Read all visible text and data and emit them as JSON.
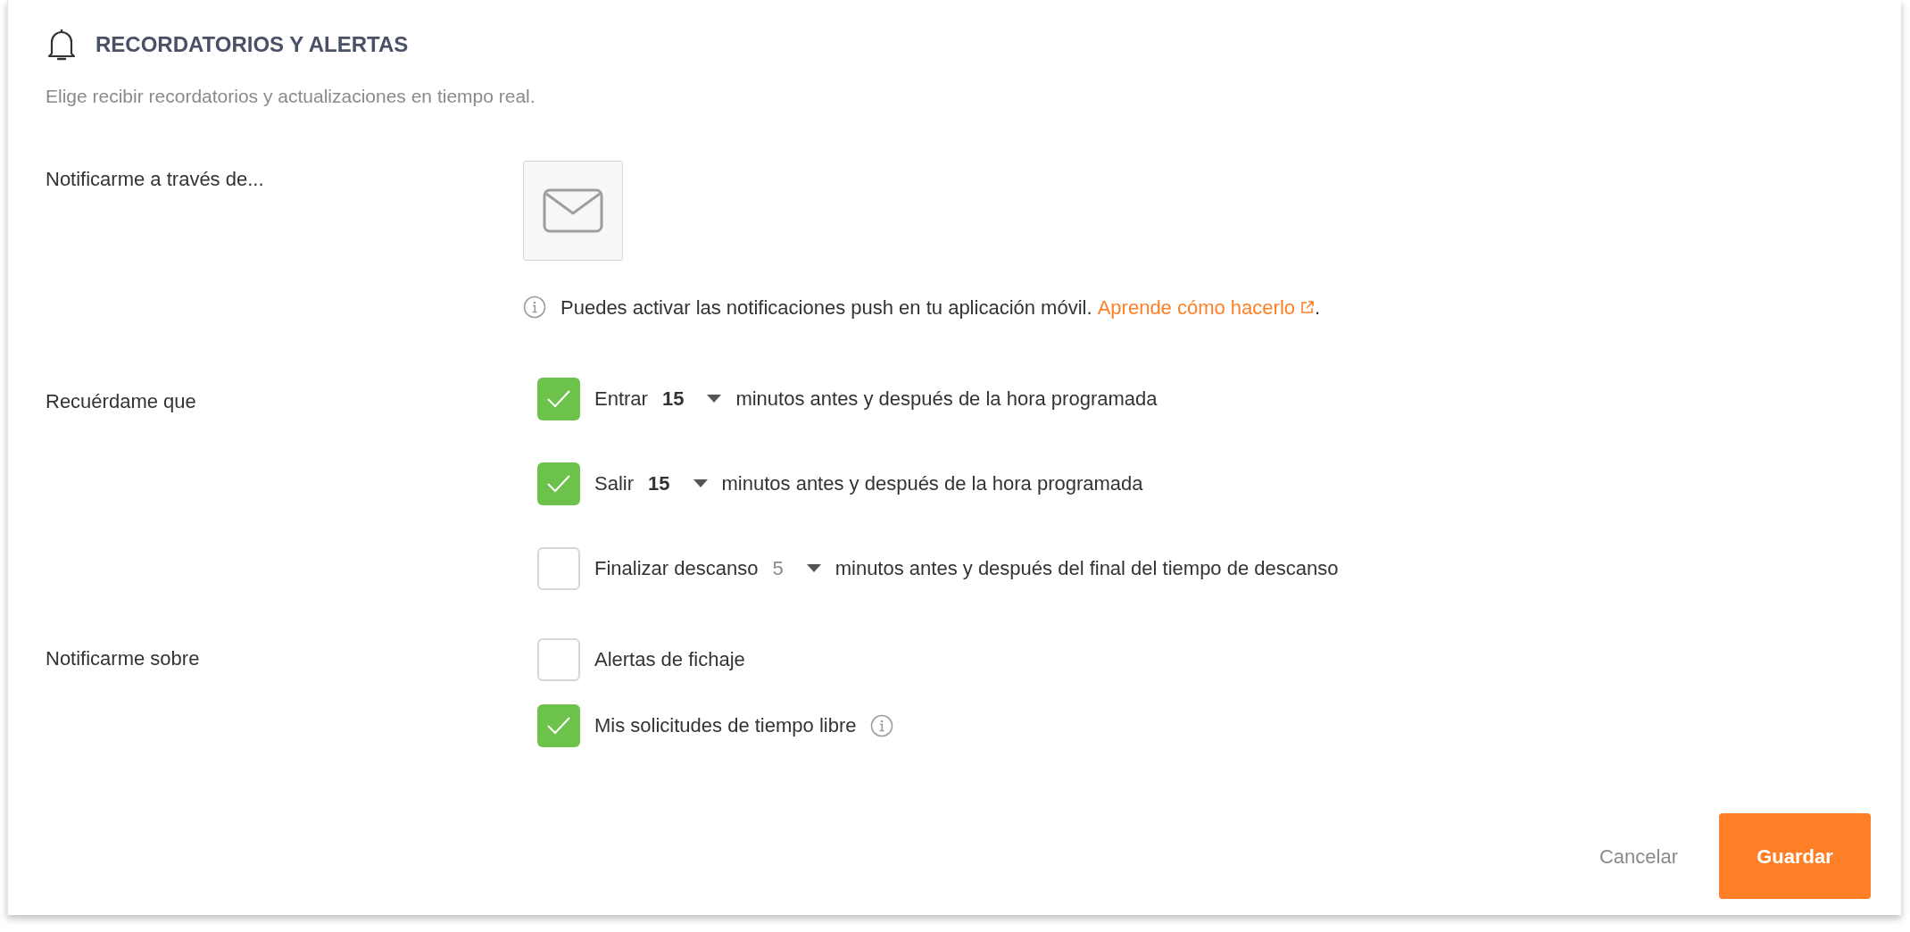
{
  "section": {
    "title": "RECORDATORIOS Y ALERTAS",
    "subtitle": "Elige recibir recordatorios y actualizaciones en tiempo real."
  },
  "channels": {
    "label": "Notificarme a través de...",
    "info": {
      "text": "Puedes activar las notificaciones push en tu aplicación móvil.",
      "link": "Aprende cómo hacerlo",
      "after": "."
    }
  },
  "reminders": {
    "label": "Recuérdame que",
    "items": [
      {
        "checked": true,
        "action": "Entrar",
        "value": "15",
        "suffix": "minutos antes y después de la hora programada"
      },
      {
        "checked": true,
        "action": "Salir",
        "value": "15",
        "suffix": "minutos antes y después de la hora programada"
      },
      {
        "checked": false,
        "action": "Finalizar descanso",
        "value": "5",
        "suffix": "minutos antes y después del final del tiempo de descanso"
      }
    ]
  },
  "notify": {
    "label": "Notificarme sobre",
    "items": [
      {
        "checked": false,
        "label": "Alertas de fichaje",
        "info": false
      },
      {
        "checked": true,
        "label": "Mis solicitudes de tiempo libre",
        "info": true
      }
    ]
  },
  "buttons": {
    "cancel": "Cancelar",
    "save": "Guardar"
  }
}
